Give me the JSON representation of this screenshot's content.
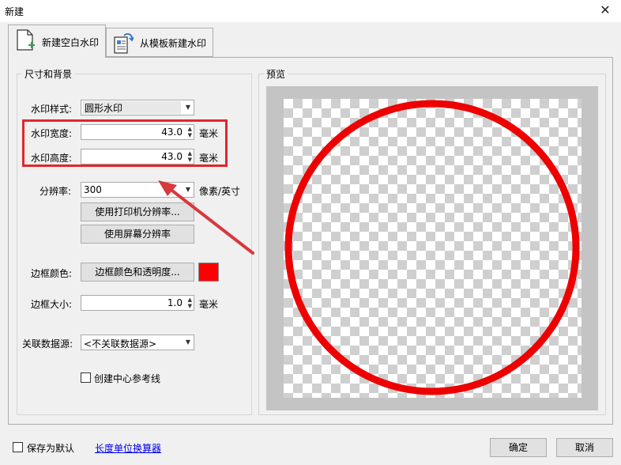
{
  "window": {
    "title": "新建",
    "close_glyph": "✕"
  },
  "tabs": [
    {
      "label": "新建空白水印",
      "icon": "new-document-icon",
      "active": true
    },
    {
      "label": "从模板新建水印",
      "icon": "template-icon",
      "active": false
    }
  ],
  "size_group": {
    "title": "尺寸和背景",
    "style_label": "水印样式:",
    "style_value": "圆形水印",
    "width_label": "水印宽度:",
    "width_value": "43.0",
    "width_unit": "毫米",
    "height_label": "水印高度:",
    "height_value": "43.0",
    "height_unit": "毫米",
    "resolution_label": "分辨率:",
    "resolution_value": "300",
    "resolution_unit": "像素/英寸",
    "printer_res_button": "使用打印机分辨率...",
    "screen_res_button": "使用屏幕分辨率",
    "border_color_label": "边框颜色:",
    "border_color_button": "边框颜色和透明度...",
    "border_color": "#ff0000",
    "border_size_label": "边框大小:",
    "border_size_value": "1.0",
    "border_size_unit": "毫米",
    "datasource_label": "关联数据源:",
    "datasource_value": "<不关联数据源>",
    "center_guides_label": "创建中心参考线",
    "center_guides_checked": false
  },
  "preview": {
    "title": "预览",
    "circle_color": "#ee0000",
    "background": "transparent-checkerboard"
  },
  "footer": {
    "save_default_label": "保存为默认",
    "save_default_checked": false,
    "unit_converter_link": "长度单位换算器",
    "ok_button": "确定",
    "cancel_button": "取消"
  },
  "annotation": {
    "highlight_color": "#e1262d"
  }
}
